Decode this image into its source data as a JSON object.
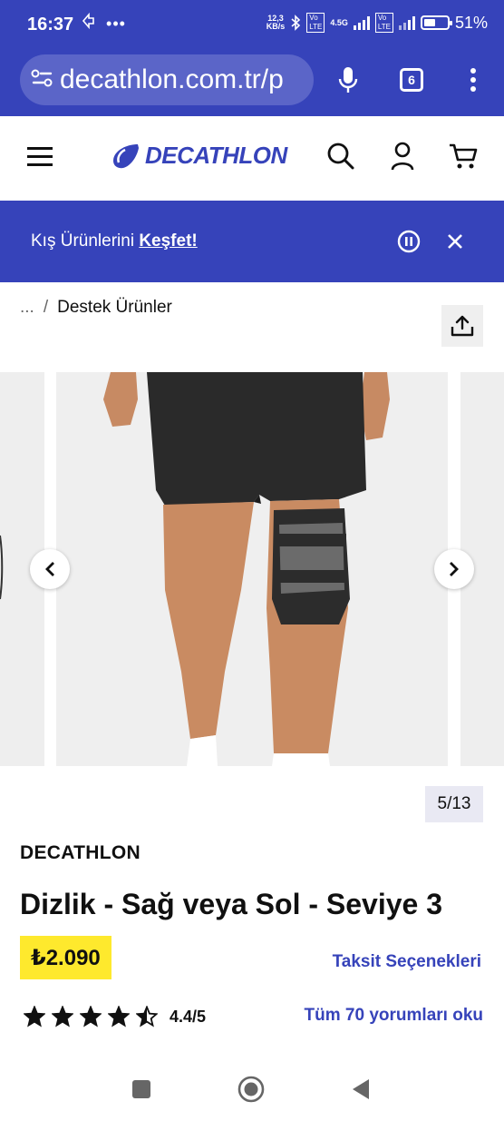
{
  "status_bar": {
    "time": "16:37",
    "net_speed_value": "12,3",
    "net_speed_unit": "KB/s",
    "network_type": "4.5G",
    "battery_percent": "51%",
    "battery_level": 0.51,
    "left_icons": [
      "navigation-icon",
      "more-icon"
    ]
  },
  "browser": {
    "url": "decathlon.com.tr/p",
    "tab_count": "6",
    "icons": [
      "site-settings-icon",
      "microphone-icon",
      "tabs-icon",
      "menu-icon"
    ]
  },
  "header": {
    "logo_text": "DECATHLON",
    "icons": [
      "hamburger-icon",
      "search-icon",
      "account-icon",
      "cart-icon"
    ]
  },
  "promo": {
    "text": "Kış Ürünlerini",
    "link": "Keşfet!",
    "icons": [
      "pause-icon",
      "close-icon"
    ]
  },
  "breadcrumb": {
    "ellipsis": "...",
    "separator": "/",
    "current": "Destek Ürünler"
  },
  "gallery": {
    "counter": "5/13",
    "current_index": 5,
    "total": 13
  },
  "product": {
    "brand": "DECATHLON",
    "title": "Dizlik - Sağ veya Sol - Seviye 3",
    "price": "₺2.090",
    "installment_link": "Taksit Seçenekleri",
    "rating_value": "4.4/5",
    "rating": 4.4,
    "reviews_link": "Tüm 70 yorumları oku"
  },
  "colors": {
    "brand_blue": "#3643ba",
    "price_yellow": "#fee92d"
  }
}
